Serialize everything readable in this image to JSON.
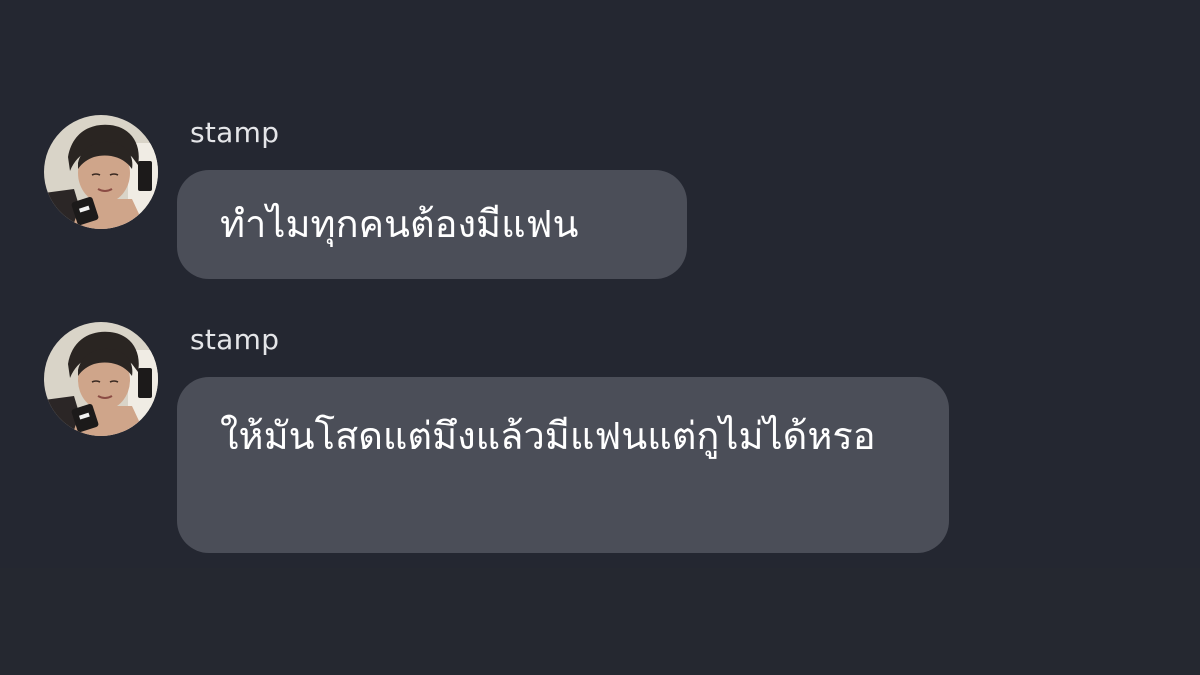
{
  "chat": {
    "messages": [
      {
        "sender": "stamp",
        "text": "ทำไมทุกคนต้องมีแฟน",
        "avatar": "user-avatar"
      },
      {
        "sender": "stamp",
        "text": "ให้มันโสดแต่มึงแล้วมีแฟนแต่กูไม่ได้หรอ",
        "avatar": "user-avatar"
      }
    ]
  },
  "colors": {
    "background": "#242731",
    "bubble": "#4b4e58",
    "sender_name": "#e4e5e8",
    "message_text": "#ffffff"
  }
}
